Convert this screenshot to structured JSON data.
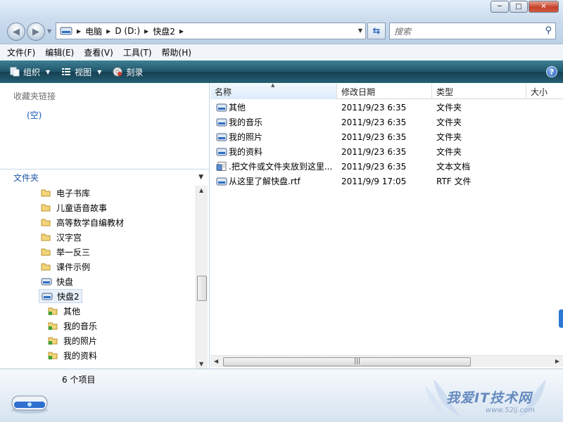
{
  "window": {
    "minimize": "─",
    "maximize": "□",
    "close": "✕"
  },
  "nav": {
    "back": "◀",
    "forward": "▶"
  },
  "address": {
    "crumbs": [
      "电脑",
      "D (D:)",
      "快盘2"
    ]
  },
  "search": {
    "placeholder": "搜索"
  },
  "menu": [
    "文件(F)",
    "编辑(E)",
    "查看(V)",
    "工具(T)",
    "帮助(H)"
  ],
  "toolbar": {
    "organize": "组织",
    "view": "视图",
    "burn": "刻录",
    "help": "?"
  },
  "left": {
    "favorites_title": "收藏夹链接",
    "favorites_empty": "(空)",
    "folders_title": "文件夹",
    "tree": [
      {
        "label": "电子书库",
        "type": "folder",
        "indent": 1
      },
      {
        "label": "儿童语音故事",
        "type": "folder",
        "indent": 1
      },
      {
        "label": "高等数学自编教材",
        "type": "folder",
        "indent": 1
      },
      {
        "label": "汉字宫",
        "type": "folder",
        "indent": 1
      },
      {
        "label": "举一反三",
        "type": "folder",
        "indent": 1
      },
      {
        "label": "课件示例",
        "type": "folder",
        "indent": 1
      },
      {
        "label": "快盘",
        "type": "drive",
        "indent": 1
      },
      {
        "label": "快盘2",
        "type": "drive",
        "indent": 1,
        "selected": true
      },
      {
        "label": "其他",
        "type": "syncfolder",
        "indent": 2
      },
      {
        "label": "我的音乐",
        "type": "syncfolder",
        "indent": 2
      },
      {
        "label": "我的照片",
        "type": "syncfolder",
        "indent": 2
      },
      {
        "label": "我的资料",
        "type": "syncfolder",
        "indent": 2
      }
    ]
  },
  "columns": {
    "name": "名称",
    "date": "修改日期",
    "type": "类型",
    "size": "大小"
  },
  "files": [
    {
      "name": "其他",
      "date": "2011/9/23 6:35",
      "type": "文件夹",
      "icon": "drive-folder"
    },
    {
      "name": "我的音乐",
      "date": "2011/9/23 6:35",
      "type": "文件夹",
      "icon": "drive-folder"
    },
    {
      "name": "我的照片",
      "date": "2011/9/23 6:35",
      "type": "文件夹",
      "icon": "drive-folder"
    },
    {
      "name": "我的资料",
      "date": "2011/9/23 6:35",
      "type": "文件夹",
      "icon": "drive-folder"
    },
    {
      "name": ".把文件或文件夹放到这里...",
      "date": "2011/9/23 6:35",
      "type": "文本文档",
      "icon": "text-doc"
    },
    {
      "name": "从这里了解快盘.rtf",
      "date": "2011/9/9 17:05",
      "type": "RTF 文件",
      "icon": "drive-folder"
    }
  ],
  "status": {
    "count": "6 个项目"
  },
  "watermark": {
    "text": "我爱IT技术网",
    "url": "www.52ij.com"
  },
  "colors": {
    "toolbar": "#1e5568",
    "link_blue": "#1f55a6",
    "selection": "#e8f0f9"
  }
}
